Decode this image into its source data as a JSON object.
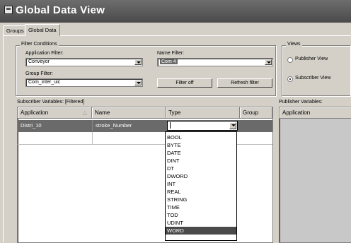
{
  "window": {
    "title": "Global Data View"
  },
  "tabs": [
    {
      "label": "Groups"
    },
    {
      "label": "Global Data"
    }
  ],
  "filter_conditions": {
    "title": "Filter Conditions",
    "application_filter": {
      "label": "Application Filter:",
      "value": "Conveyor"
    },
    "name_filter": {
      "label": "Name Filter:",
      "value": "Com 4"
    },
    "group_filter": {
      "label": "Group Filter:",
      "value": "Com_inter_uic"
    },
    "filter_button": "Filter off",
    "refresh_button": "Refresh filter"
  },
  "views": {
    "title": "Views",
    "publisher": {
      "label": "Publisher View",
      "selected": false
    },
    "subscriber": {
      "label": "Subscriber View",
      "selected": true
    }
  },
  "subscriber_table": {
    "label": "Subscriber Variables: [Filtered]",
    "columns": [
      "Application",
      "Name",
      "Type",
      "Group"
    ],
    "rows": [
      {
        "application": "Distri_10",
        "name": "stroke_Number",
        "type": "",
        "group": ""
      }
    ]
  },
  "publisher_table": {
    "label": "Publisher Variables:",
    "columns": [
      "Application"
    ]
  },
  "type_dropdown": {
    "options": [
      "BOOL",
      "BYTE",
      "DATE",
      "DINT",
      "DT",
      "DWORD",
      "INT",
      "REAL",
      "STRING",
      "TIME",
      "TOD",
      "UDINT",
      "WORD"
    ],
    "highlighted": "WORD"
  }
}
